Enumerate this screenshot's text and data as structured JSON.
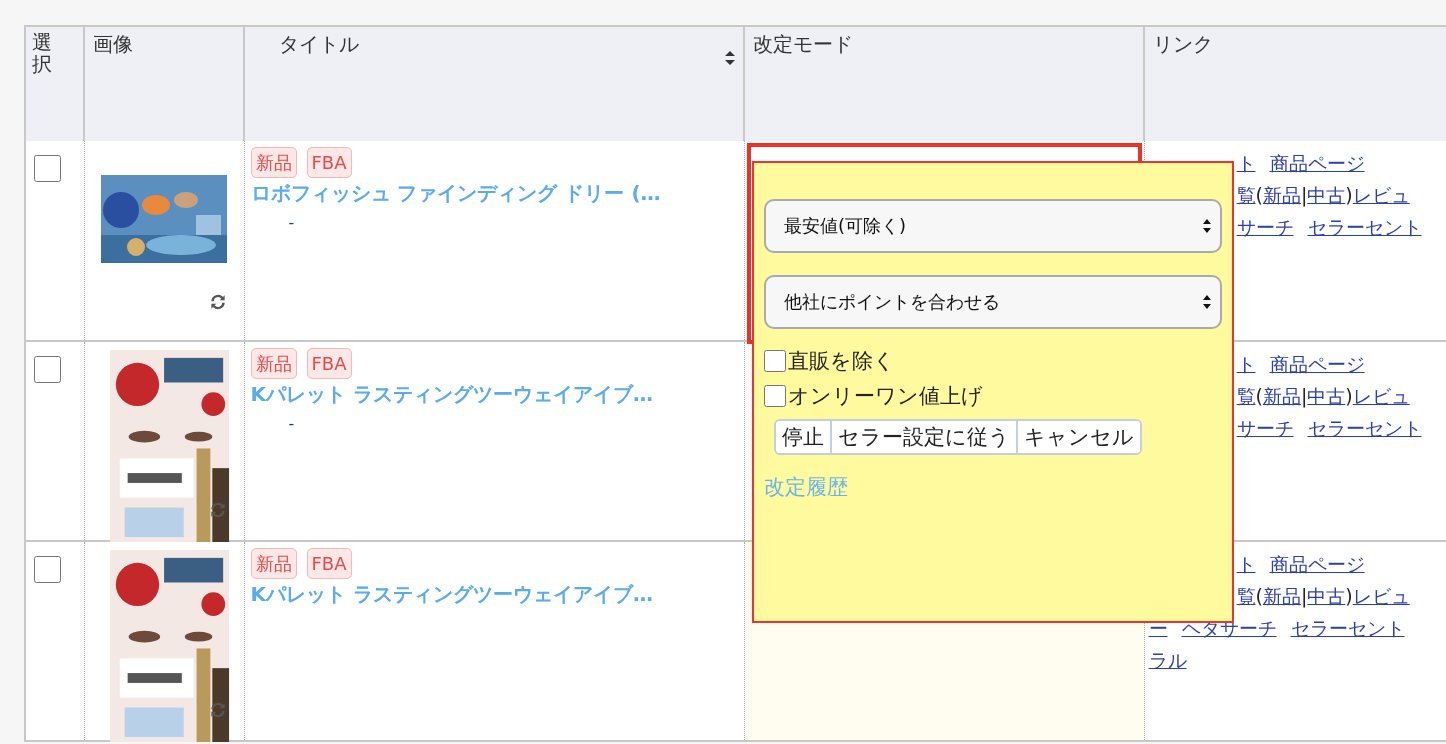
{
  "columns": [
    {
      "label": "選択",
      "kind": "vertical"
    },
    {
      "label": "画像",
      "kind": "plain"
    },
    {
      "label": "タイトル",
      "kind": "sortable"
    },
    {
      "label": "改定モード",
      "kind": "plain"
    },
    {
      "label": "リンク",
      "kind": "plain"
    }
  ],
  "rows": [
    {
      "checked": false,
      "badges": [
        "新品",
        "FBA"
      ],
      "title": "ロボフィッシュ ファインディング ドリー (…",
      "subtitle": "-",
      "selected": true,
      "highlighted": false,
      "links": [
        [
          {
            "text": "ト",
            "link": true
          },
          {
            "text": "商品ページ",
            "link": true
          }
        ],
        [
          {
            "text": "覧",
            "link": true
          },
          {
            "text": "(",
            "link": false
          },
          {
            "text": "新品",
            "link": true
          },
          {
            "text": "|",
            "link": false
          },
          {
            "text": "中古",
            "link": true
          },
          {
            "text": ")",
            "link": false
          },
          {
            "text": "レビュ",
            "link": true
          }
        ],
        [
          {
            "text": "サーチ",
            "link": true
          },
          {
            "text": "セラーセント",
            "link": true
          }
        ]
      ]
    },
    {
      "checked": false,
      "badges": [
        "新品",
        "FBA"
      ],
      "title": "Kパレット ラスティングツーウェイアイブ…",
      "subtitle": "-",
      "selected": false,
      "highlighted": false,
      "links": [
        [
          {
            "text": "ト",
            "link": true
          },
          {
            "text": "商品ページ",
            "link": true
          }
        ],
        [
          {
            "text": "覧",
            "link": true
          },
          {
            "text": "(",
            "link": false
          },
          {
            "text": "新品",
            "link": true
          },
          {
            "text": "|",
            "link": false
          },
          {
            "text": "中古",
            "link": true
          },
          {
            "text": ")",
            "link": false
          },
          {
            "text": "レビュ",
            "link": true
          }
        ],
        [
          {
            "text": "サーチ",
            "link": true
          },
          {
            "text": "セラーセント",
            "link": true
          }
        ]
      ]
    },
    {
      "checked": false,
      "badges": [
        "新品",
        "FBA"
      ],
      "title": "Kパレット ラスティングツーウェイアイブ…",
      "selected": false,
      "highlighted": true,
      "links": [
        [
          {
            "text": "ト",
            "link": true
          },
          {
            "text": "商品ページ",
            "link": true
          }
        ],
        [
          {
            "text": "覧",
            "link": true
          },
          {
            "text": "(",
            "link": false
          },
          {
            "text": "新品",
            "link": true
          },
          {
            "text": "|",
            "link": false
          },
          {
            "text": "中古",
            "link": true
          },
          {
            "text": ")",
            "link": false
          },
          {
            "text": "レビュ",
            "link": true
          }
        ],
        [
          {
            "text": "ー",
            "link": true
          },
          {
            "text": "ヘタサーチ",
            "link": true
          },
          {
            "text": "セラーセント",
            "link": true
          }
        ],
        [
          {
            "text": "ラル",
            "link": true
          }
        ]
      ]
    }
  ],
  "popup": {
    "selects": [
      "最安値(可除く)",
      "他社にポイントを合わせる"
    ],
    "checkboxes": [
      {
        "label": "直販を除く",
        "checked": false
      },
      {
        "label": "オンリーワン値上げ",
        "checked": false
      }
    ],
    "buttons": [
      "停止",
      "セラー設定に従う",
      "キャンセル"
    ],
    "history_link": "改定履歴"
  }
}
